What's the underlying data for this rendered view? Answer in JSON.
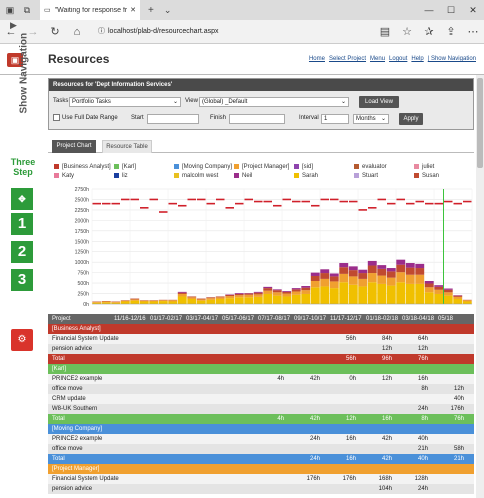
{
  "browser": {
    "tab_title": "\"Waiting for response fr",
    "url": "localhost/plab-d/resourcechart.aspx",
    "new_tab": "+",
    "tab_menu": "⌄"
  },
  "app": {
    "title": "Resources",
    "links": [
      "Home",
      "Select Project",
      "Menu",
      "Logout",
      "Help",
      "| Show Navigation"
    ]
  },
  "sidebar": {
    "show_navigation": "Show Navigation",
    "three_step_line1": "Three",
    "three_step_line2": "Step",
    "steps": [
      "1",
      "2",
      "3"
    ]
  },
  "panel": {
    "title": "Resources for 'Dept Information Services'",
    "tasks_label": "Tasks",
    "tasks_value": "Portfolio Tasks",
    "view_label": "View",
    "view_value": "(Global) _Default",
    "load_view": "Load View",
    "full_date_label": "Use Full Date Range",
    "start_label": "Start",
    "finish_label": "Finish",
    "interval_label": "Interval",
    "interval_value": "1",
    "interval_unit": "Months",
    "apply": "Apply"
  },
  "tabs": [
    "Project Chart",
    "Resource Table"
  ],
  "colors": {
    "accent_green": "#2d9b3a",
    "red": "#c0392b",
    "dark": "#4a4a4a"
  },
  "chart_data": {
    "type": "bar",
    "ylim": [
      0,
      2750
    ],
    "yticks": [
      "2750h",
      "2500h",
      "2250h",
      "2000h",
      "1750h",
      "1500h",
      "1250h",
      "1000h",
      "750h",
      "500h",
      "250h",
      "0h"
    ],
    "legend": [
      {
        "name": "[Business Analyst]",
        "color": "#c0392b"
      },
      {
        "name": "[Karl]",
        "color": "#6cbf5b"
      },
      {
        "name": "[Moving Company]",
        "color": "#4a90d9"
      },
      {
        "name": "[Project Manager]",
        "color": "#f0a030"
      },
      {
        "name": "[sid]",
        "color": "#8e44ad"
      },
      {
        "name": "evaluator",
        "color": "#b55a30"
      },
      {
        "name": "juliet",
        "color": "#e88aa0"
      },
      {
        "name": "Katy",
        "color": "#e87a9a"
      },
      {
        "name": "liz",
        "color": "#1a3fa0"
      },
      {
        "name": "malcolm west",
        "color": "#e8c020"
      },
      {
        "name": "Neil",
        "color": "#9b2d8b"
      },
      {
        "name": "Sarah",
        "color": "#f0c000"
      },
      {
        "name": "Stuart",
        "color": "#b8a0d8"
      },
      {
        "name": "Susan",
        "color": "#c04a30"
      }
    ],
    "capacity_line": [
      2400,
      2400,
      2400,
      2500,
      2500,
      2300,
      2500,
      2200,
      2400,
      2350,
      2500,
      2500,
      2400,
      2500,
      2300,
      2400,
      2500,
      2450,
      2450,
      2350,
      2500,
      2450,
      2450,
      2350,
      2500,
      2500,
      2450,
      2450,
      2250,
      2300,
      2500,
      2400,
      2500,
      2400,
      2450,
      2400,
      2400,
      2450,
      2400,
      2450
    ],
    "stacks": [
      [
        30,
        20,
        10,
        0
      ],
      [
        40,
        20,
        10,
        0
      ],
      [
        30,
        20,
        10,
        0
      ],
      [
        60,
        20,
        10,
        0
      ],
      [
        80,
        30,
        20,
        0
      ],
      [
        60,
        20,
        10,
        0
      ],
      [
        60,
        20,
        10,
        0
      ],
      [
        70,
        20,
        10,
        0
      ],
      [
        60,
        30,
        10,
        0
      ],
      [
        180,
        60,
        30,
        20
      ],
      [
        120,
        40,
        20,
        0
      ],
      [
        80,
        30,
        20,
        0
      ],
      [
        100,
        40,
        20,
        0
      ],
      [
        120,
        40,
        20,
        0
      ],
      [
        140,
        50,
        30,
        10
      ],
      [
        160,
        50,
        30,
        20
      ],
      [
        160,
        60,
        30,
        10
      ],
      [
        170,
        60,
        40,
        20
      ],
      [
        240,
        80,
        60,
        30
      ],
      [
        200,
        80,
        50,
        20
      ],
      [
        180,
        70,
        40,
        20
      ],
      [
        220,
        80,
        50,
        30
      ],
      [
        240,
        90,
        60,
        40
      ],
      [
        400,
        150,
        120,
        80
      ],
      [
        420,
        180,
        140,
        90
      ],
      [
        380,
        160,
        120,
        70
      ],
      [
        520,
        200,
        160,
        100
      ],
      [
        460,
        200,
        150,
        90
      ],
      [
        420,
        180,
        140,
        80
      ],
      [
        520,
        220,
        180,
        110
      ],
      [
        480,
        200,
        160,
        90
      ],
      [
        440,
        190,
        150,
        80
      ],
      [
        520,
        240,
        180,
        120
      ],
      [
        480,
        220,
        170,
        110
      ],
      [
        480,
        220,
        160,
        100
      ],
      [
        280,
        120,
        90,
        60
      ],
      [
        240,
        100,
        70,
        40
      ],
      [
        200,
        80,
        60,
        30
      ],
      [
        120,
        50,
        30,
        10
      ],
      [
        60,
        30,
        10,
        0
      ]
    ],
    "stack_colors": [
      "#f0c000",
      "#f0a030",
      "#c04a30",
      "#9b2d8b"
    ]
  },
  "table": {
    "header": "Project",
    "dates": [
      "11/16-12/16",
      "01/17-02/17",
      "03/17-04/17",
      "05/17-06/17",
      "07/17-08/17",
      "09/17-10/17",
      "11/17-12/17",
      "01/18-02/18",
      "03/18-04/18",
      "05/18"
    ],
    "groups": [
      {
        "name": "[Business Analyst]",
        "color": "#c0392b",
        "rows": [
          {
            "name": "Financial System Update",
            "cells": [
              "",
              "",
              "",
              "",
              "",
              "",
              "56h",
              "84h",
              "64h",
              ""
            ]
          },
          {
            "name": "pension advice",
            "cells": [
              "",
              "",
              "",
              "",
              "",
              "",
              "",
              "12h",
              "12h",
              ""
            ]
          }
        ],
        "total": [
          "",
          "",
          "",
          "",
          "",
          "",
          "56h",
          "96h",
          "76h",
          ""
        ]
      },
      {
        "name": "[Karl]",
        "color": "#6cbf5b",
        "rows": [
          {
            "name": "PRINCE2 example",
            "cells": [
              "",
              "",
              "",
              "",
              "4h",
              "42h",
              "0h",
              "12h",
              "16h",
              ""
            ]
          },
          {
            "name": "office move",
            "cells": [
              "",
              "",
              "",
              "",
              "",
              "",
              "",
              "",
              "8h",
              "12h"
            ]
          },
          {
            "name": "CRM update",
            "cells": [
              "",
              "",
              "",
              "",
              "",
              "",
              "",
              "",
              "",
              "40h"
            ]
          },
          {
            "name": "W8-UK Southern",
            "cells": [
              "",
              "",
              "",
              "",
              "",
              "",
              "",
              "",
              "24h",
              "176h"
            ]
          }
        ],
        "total": [
          "",
          "",
          "",
          "",
          "4h",
          "42h",
          "12h",
          "16h",
          "8h",
          "76h"
        ]
      },
      {
        "name": "[Moving Company]",
        "color": "#4a90d9",
        "rows": [
          {
            "name": "PRINCE2 example",
            "cells": [
              "",
              "",
              "",
              "",
              "",
              "24h",
              "16h",
              "42h",
              "40h",
              ""
            ]
          },
          {
            "name": "office move",
            "cells": [
              "",
              "",
              "",
              "",
              "",
              "",
              "",
              "",
              "21h",
              "58h"
            ]
          }
        ],
        "total": [
          "",
          "",
          "",
          "",
          "",
          "24h",
          "16h",
          "42h",
          "40h",
          "21h"
        ]
      },
      {
        "name": "[Project Manager]",
        "color": "#f0a030",
        "rows": [
          {
            "name": "Financial System Update",
            "cells": [
              "",
              "",
              "",
              "",
              "",
              "176h",
              "176h",
              "168h",
              "128h",
              ""
            ]
          },
          {
            "name": "pension advice",
            "cells": [
              "",
              "",
              "",
              "",
              "",
              "",
              "",
              "104h",
              "24h",
              ""
            ]
          }
        ],
        "total": []
      }
    ],
    "total_label": "Total"
  }
}
